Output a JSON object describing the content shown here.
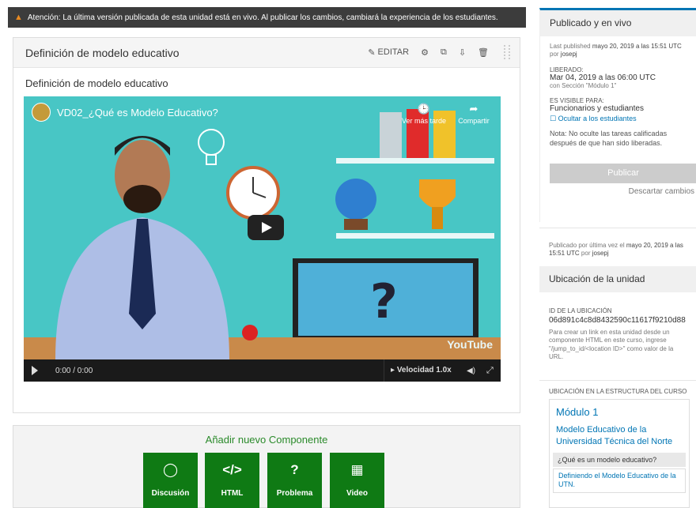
{
  "banner": {
    "text": "Atención: La última versión publicada de esta unidad está en vivo. Al publicar los cambios, cambiará la experiencia de los estudiantes."
  },
  "component": {
    "title": "Definición de modelo educativo",
    "edit_label": "EDITAR",
    "subtitle": "Definición de modelo educativo"
  },
  "video": {
    "title": "VD02_¿Qué es Modelo Educativo?",
    "watch_later": "Ver más tarde",
    "share": "Compartir",
    "youtube": "YouTube",
    "time": "0:00 / 0:00",
    "speed": "Velocidad 1.0x"
  },
  "add_component": {
    "title": "Añadir nuevo Componente",
    "buttons": [
      "Discusión",
      "HTML",
      "Problema",
      "Video"
    ]
  },
  "sidebar": {
    "publish_title": "Publicado y en vivo",
    "last_published_prefix": "Last published",
    "last_published_date": "mayo 20, 2019 a las 15:51 UTC",
    "last_published_by_prefix": "por",
    "last_published_user": "josepj",
    "released_label": "LIBERADO:",
    "released_value": "Mar 04, 2019 a las 06:00 UTC",
    "released_section": "con Sección \"Módulo 1\"",
    "visible_label": "ES VISIBLE PARA:",
    "visible_value": "Funcionarios y estudiantes",
    "hide_link": "Ocultar a los estudiantes",
    "note": "Nota: No oculte las tareas calificadas después de que han sido liberadas.",
    "publish_button": "Publicar",
    "discard": "Descartar cambios",
    "published_footer_prefix": "Publicado por última vez el",
    "published_footer_date": "mayo 20, 2019 a las 15:51 UTC",
    "published_footer_by": "por",
    "published_footer_user": "josepj",
    "location_title": "Ubicación de la unidad",
    "location_id_label": "ID DE LA UBICACIÓN",
    "location_id": "06d891c4c8d8432590c11617f9210d88",
    "location_help": "Para crear un link en esta unidad desde un componente HTML en este curso, ingrese \"/jump_to_id/<location ID>\" como valor de la URL.",
    "structure_label": "UBICACIÓN EN LA ESTRUCTURA DEL CURSO",
    "module": "Módulo 1",
    "section": "Modelo Educativo de la Universidad Técnica del Norte",
    "current_unit": "¿Qué es un modelo educativo?",
    "next_unit": "Definiendo el Modelo Educativo de la UTN."
  }
}
